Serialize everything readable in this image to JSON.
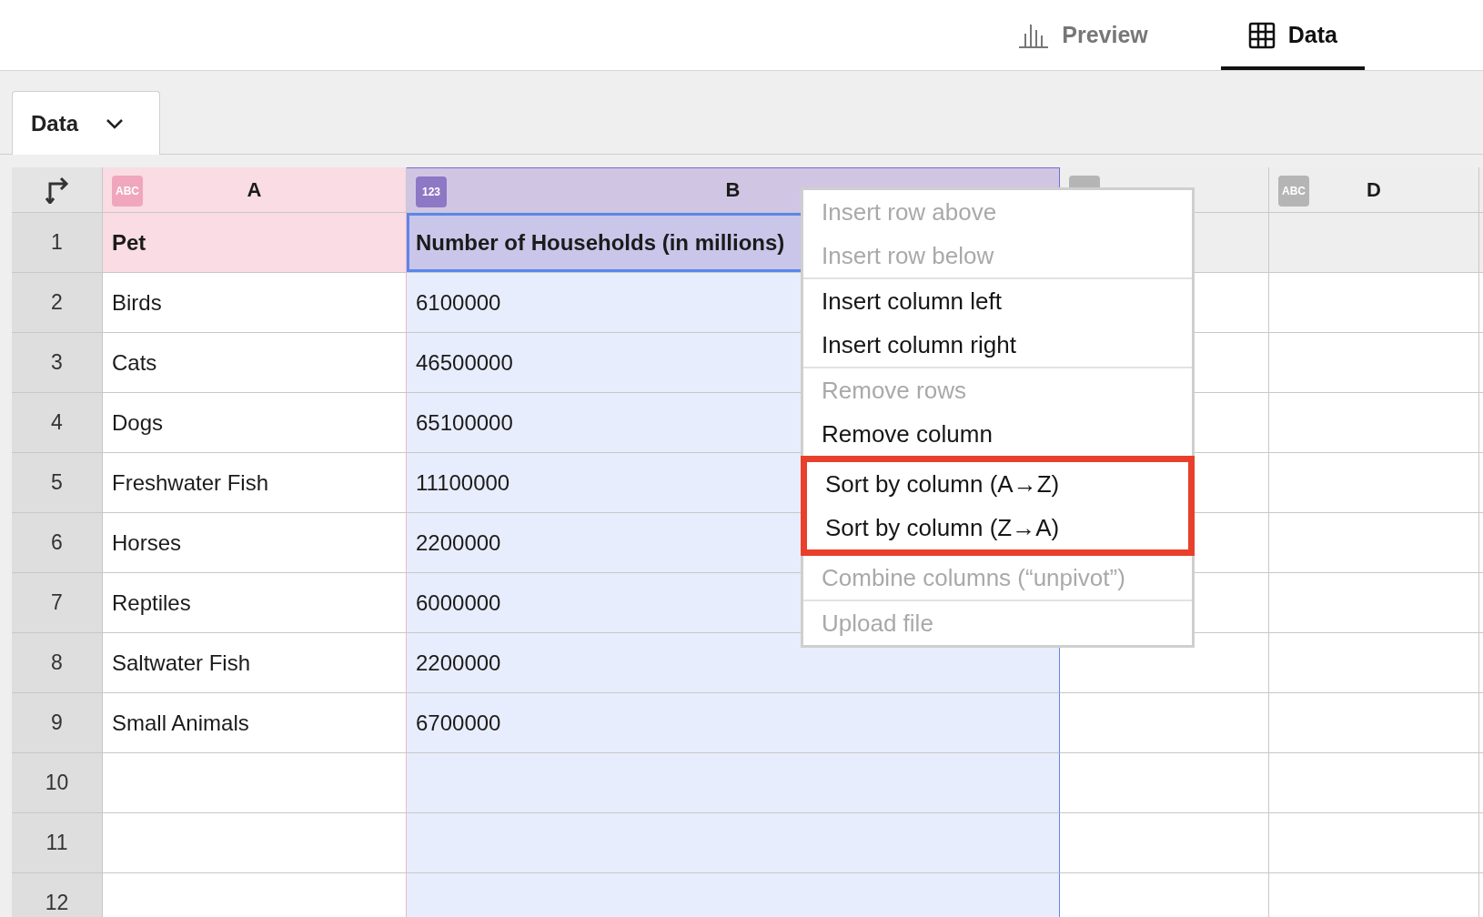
{
  "view_tabs": [
    {
      "label": "Preview",
      "kind": "chart",
      "selected": false
    },
    {
      "label": "Data",
      "kind": "table",
      "selected": true
    }
  ],
  "sheet_tab": {
    "label": "Data"
  },
  "columns": [
    {
      "letter": "A",
      "type": "ABC",
      "color": "#f9dce4",
      "selected": false
    },
    {
      "letter": "B",
      "type": "123",
      "color": "#d0c6e4",
      "selected": true
    },
    {
      "color": "#eeeeee",
      "selected": false
    },
    {
      "letter": "D",
      "type": "ABC",
      "color": "#eeeeee",
      "selected": false
    }
  ],
  "rows": [
    {
      "number": "1",
      "kind": "header",
      "cells": [
        "Pet",
        "Number of Households (in millions)"
      ]
    },
    {
      "number": "2",
      "kind": "data",
      "cells": [
        "Birds",
        "6100000"
      ]
    },
    {
      "number": "3",
      "kind": "data",
      "cells": [
        "Cats",
        "46500000"
      ]
    },
    {
      "number": "4",
      "kind": "data",
      "cells": [
        "Dogs",
        "65100000"
      ]
    },
    {
      "number": "5",
      "kind": "data",
      "cells": [
        "Freshwater Fish",
        "11100000"
      ]
    },
    {
      "number": "6",
      "kind": "data",
      "cells": [
        "Horses",
        "2200000"
      ]
    },
    {
      "number": "7",
      "kind": "data",
      "cells": [
        "Reptiles",
        "6000000"
      ]
    },
    {
      "number": "8",
      "kind": "data",
      "cells": [
        "Saltwater Fish",
        "2200000"
      ]
    },
    {
      "number": "9",
      "kind": "data",
      "cells": [
        "Small Animals",
        "6700000"
      ]
    },
    {
      "number": "10",
      "kind": "data"
    },
    {
      "number": "11",
      "kind": "data"
    },
    {
      "number": "12",
      "kind": "data"
    }
  ],
  "context_menu": {
    "groups": [
      {
        "highlighted": false,
        "items": [
          {
            "label": "Insert row above",
            "disabled": true
          },
          {
            "label": "Insert row below",
            "disabled": true
          }
        ]
      },
      {
        "highlighted": false,
        "items": [
          {
            "label": "Insert column left",
            "disabled": false
          },
          {
            "label": "Insert column right",
            "disabled": false
          }
        ]
      },
      {
        "highlighted": false,
        "items": [
          {
            "label": "Remove rows",
            "disabled": true
          },
          {
            "label": "Remove column",
            "disabled": false
          }
        ]
      },
      {
        "highlighted": true,
        "items": [
          {
            "label": "Sort by column (A→Z)",
            "disabled": false
          },
          {
            "label": "Sort by column (Z→A)",
            "disabled": false
          }
        ]
      },
      {
        "highlighted": false,
        "items": [
          {
            "label": "Combine columns (“unpivot”)",
            "disabled": true
          }
        ]
      },
      {
        "highlighted": false,
        "items": [
          {
            "label": "Upload file",
            "disabled": true
          }
        ]
      }
    ]
  }
}
